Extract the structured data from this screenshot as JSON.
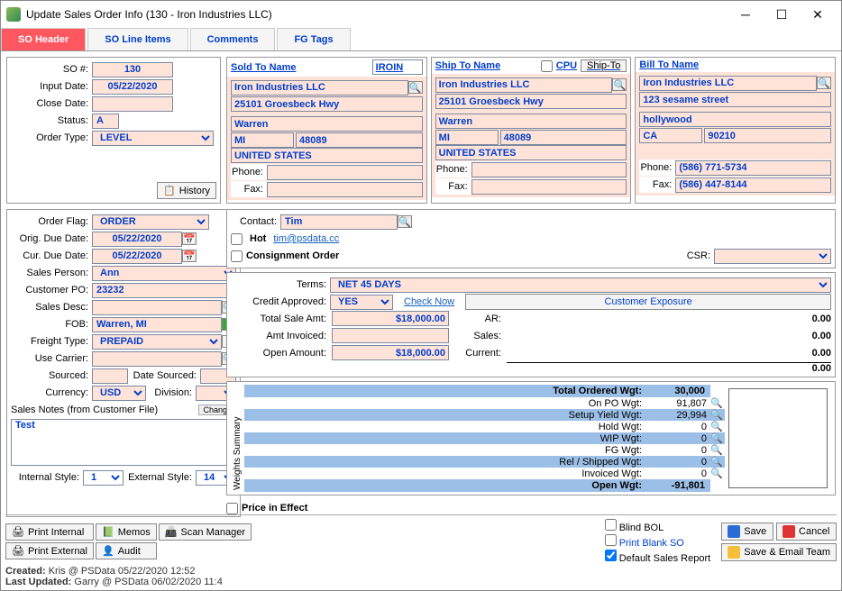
{
  "window": {
    "title": "Update Sales Order Info  (130 - Iron Industries LLC)"
  },
  "tabs": {
    "header": "SO Header",
    "line": "SO Line Items",
    "comments": "Comments",
    "fg": "FG Tags"
  },
  "so": {
    "so_num_lbl": "SO #:",
    "so_num": "130",
    "input_date_lbl": "Input Date:",
    "input_date": "05/22/2020",
    "close_date_lbl": "Close Date:",
    "close_date": "",
    "status_lbl": "Status:",
    "status": "A",
    "order_type_lbl": "Order Type:",
    "order_type": "LEVEL",
    "history_btn": "History"
  },
  "flags": {
    "order_flag_lbl": "Order Flag:",
    "order_flag": "ORDER",
    "orig_due_lbl": "Orig. Due Date:",
    "orig_due": "05/22/2020",
    "cur_due_lbl": "Cur. Due Date:",
    "cur_due": "05/22/2020",
    "sales_person_lbl": "Sales Person:",
    "sales_person": "Ann",
    "cust_po_lbl": "Customer PO:",
    "cust_po": "23232",
    "sales_desc_lbl": "Sales Desc:",
    "sales_desc": "",
    "fob_lbl": "FOB:",
    "fob": "Warren, MI",
    "freight_lbl": "Freight Type:",
    "freight": "PREPAID",
    "freight_help": "?",
    "carrier_lbl": "Use Carrier:",
    "carrier": "",
    "sourced_lbl": "Sourced:",
    "sourced": "",
    "date_sourced_lbl": "Date Sourced:",
    "date_sourced": "",
    "currency_lbl": "Currency:",
    "currency": "USD",
    "division_lbl": "Division:",
    "division": "",
    "notes_lbl": "Sales Notes (from Customer File)",
    "notes": "Test",
    "change": "Change",
    "contact_lbl": "Contact:",
    "contact": "Tim",
    "email": "tim@psdata.cc",
    "hot": "Hot",
    "consign": "Consignment Order",
    "csr_lbl": "CSR:"
  },
  "sold": {
    "title": "Sold To Name",
    "code": "IROIN",
    "name": "Iron Industries LLC",
    "addr": "25101 Groesbeck Hwy",
    "city": "Warren",
    "state": "MI",
    "zip": "48089",
    "country": "UNITED STATES",
    "phone_lbl": "Phone:",
    "fax_lbl": "Fax:"
  },
  "ship": {
    "title": "Ship To Name",
    "cpu": "CPU",
    "shipto_btn": "Ship-To",
    "name": "Iron Industries LLC",
    "addr": "25101 Groesbeck Hwy",
    "city": "Warren",
    "state": "MI",
    "zip": "48089",
    "country": "UNITED STATES",
    "phone_lbl": "Phone:",
    "fax_lbl": "Fax:"
  },
  "bill": {
    "title": "Bill To Name",
    "name": "Iron Industries LLC",
    "addr": "123 sesame street",
    "city": "hollywood",
    "state": "CA",
    "zip": "90210",
    "phone_lbl": "Phone:",
    "phone": "(586) 771-5734",
    "fax_lbl": "Fax:",
    "fax": "(586) 447-8144"
  },
  "fin": {
    "terms_lbl": "Terms:",
    "terms": "NET 45 DAYS",
    "credit_lbl": "Credit Approved:",
    "credit": "YES",
    "check": "Check Now",
    "exposure": "Customer Exposure",
    "total_sale_lbl": "Total Sale Amt:",
    "total_sale": "$18,000.00",
    "amt_inv_lbl": "Amt Invoiced:",
    "amt_inv": "",
    "open_amt_lbl": "Open Amount:",
    "open_amt": "$18,000.00",
    "ar_lbl": "AR:",
    "ar": "0.00",
    "sales_lbl": "Sales:",
    "sales": "0.00",
    "current_lbl": "Current:",
    "current": "0.00",
    "total": "0.00"
  },
  "wgt": {
    "group": "Weights Summary",
    "total_lbl": "Total Ordered Wgt:",
    "total": "30,000",
    "po_lbl": "On PO Wgt:",
    "po": "91,807",
    "setup_lbl": "Setup Yield Wgt:",
    "setup": "29,994",
    "hold_lbl": "Hold Wgt:",
    "hold": "0",
    "wip_lbl": "WIP Wgt:",
    "wip": "0",
    "fg_lbl": "FG Wgt:",
    "fg": "0",
    "rel_lbl": "Rel / Shipped Wgt:",
    "rel": "0",
    "inv_lbl": "Invoiced Wgt:",
    "inv": "0",
    "open_lbl": "Open Wgt:",
    "open": "-91,801"
  },
  "style": {
    "int_lbl": "Internal Style:",
    "int": "1",
    "ext_lbl": "External Style:",
    "ext": "14",
    "price": "Price in Effect"
  },
  "footer": {
    "print_int": "Print Internal",
    "print_ext": "Print External",
    "memos": "Memos",
    "scan": "Scan Manager",
    "audit": "Audit",
    "blind": "Blind BOL",
    "blank": "Print Blank SO",
    "default": "Default Sales Report",
    "save": "Save",
    "cancel": "Cancel",
    "email": "Save & Email Team"
  },
  "meta": {
    "created_lbl": "Created:",
    "created": "Kris @ PSData 05/22/2020 12:52",
    "updated_lbl": "Last Updated:",
    "updated": "Garry @ PSData 06/02/2020 11:4"
  }
}
